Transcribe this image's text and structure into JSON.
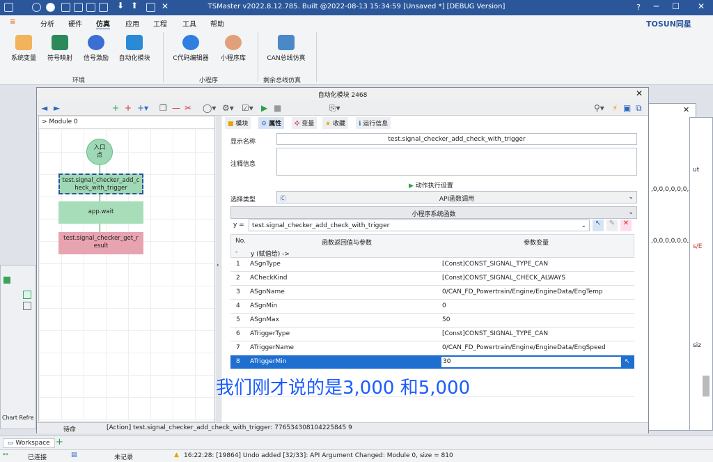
{
  "app": {
    "title": "TSMaster v2022.8.12.785. Built @2022-08-13 15:34:59 [Unsaved *] [DEBUG Version]",
    "brand": "TOSUN同星",
    "help": "?"
  },
  "menu": [
    "分析",
    "硬件",
    "仿真",
    "应用",
    "工程",
    "工具",
    "帮助"
  ],
  "ribbon": {
    "buttons": [
      "系统变量",
      "符号映射",
      "信号激励",
      "自动化模块",
      "C代码编辑器",
      "小程序库",
      "CAN总线仿真"
    ],
    "groups": [
      "环境",
      "小程序",
      "剩余总线仿真"
    ]
  },
  "dialog": {
    "title": "自动化模块 2468",
    "module_label": "> Module 0"
  },
  "flow": {
    "nodes": [
      "入口\n点",
      "test.signal_checker_add_c\nheck_with_trigger",
      "app.wait",
      "test.signal_checker_get_r\nesult"
    ]
  },
  "tabs": [
    "模块",
    "属性",
    "变量",
    "收藏",
    "运行信息"
  ],
  "props": {
    "display_name_label": "显示名称",
    "display_name": "test.signal_checker_add_check_with_trigger",
    "comment_label": "注释信息",
    "action_settings": "动作执行设置",
    "select_type_label": "选择类型",
    "select_type": "API函数调用",
    "category": "小程序系统函数",
    "y_prefix": "y =",
    "function": "test.signal_checker_add_check_with_trigger",
    "headers": {
      "no": "No.",
      "param": "函数返回值与参数",
      "var": "参数变量"
    },
    "row0": {
      "no": "-",
      "param": "y (赋值给) ->",
      "var": ""
    },
    "rows": [
      {
        "no": "1",
        "param": "ASgnType",
        "var": "[Const]CONST_SIGNAL_TYPE_CAN"
      },
      {
        "no": "2",
        "param": "ACheckKind",
        "var": "[Const]CONST_SIGNAL_CHECK_ALWAYS"
      },
      {
        "no": "3",
        "param": "ASgnName",
        "var": "0/CAN_FD_Powertrain/Engine/EngineData/EngTemp"
      },
      {
        "no": "4",
        "param": "ASgnMin",
        "var": "0"
      },
      {
        "no": "5",
        "param": "ASgnMax",
        "var": "50"
      },
      {
        "no": "6",
        "param": "ATriggerType",
        "var": "[Const]CONST_SIGNAL_TYPE_CAN"
      },
      {
        "no": "7",
        "param": "ATriggerName",
        "var": "0/CAN_FD_Powertrain/Engine/EngineData/EngSpeed"
      },
      {
        "no": "8",
        "param": "ATriggerMin",
        "var": "30"
      }
    ]
  },
  "status": {
    "state": "待命",
    "action": "[Action] test.signal_checker_add_check_with_trigger: 776534308104225845 9"
  },
  "workspace": {
    "tab": "Workspace",
    "plus": "+"
  },
  "left_panel": {
    "label": "Chart Refre"
  },
  "footer": {
    "conn": "已连接",
    "rec": "未记录",
    "log": "16:22:28: [19864] Undo added [32/33]: API Argument Changed: Module 0, size = 810"
  },
  "subtitle": "我们刚才说的是3,000 和5,000",
  "bg_text": {
    "a": ",0,0,0,0,0,0,",
    "b": ",0,0,0,0,0,0,0",
    "c": "ut",
    "d": "s/E",
    "e": "siz"
  }
}
